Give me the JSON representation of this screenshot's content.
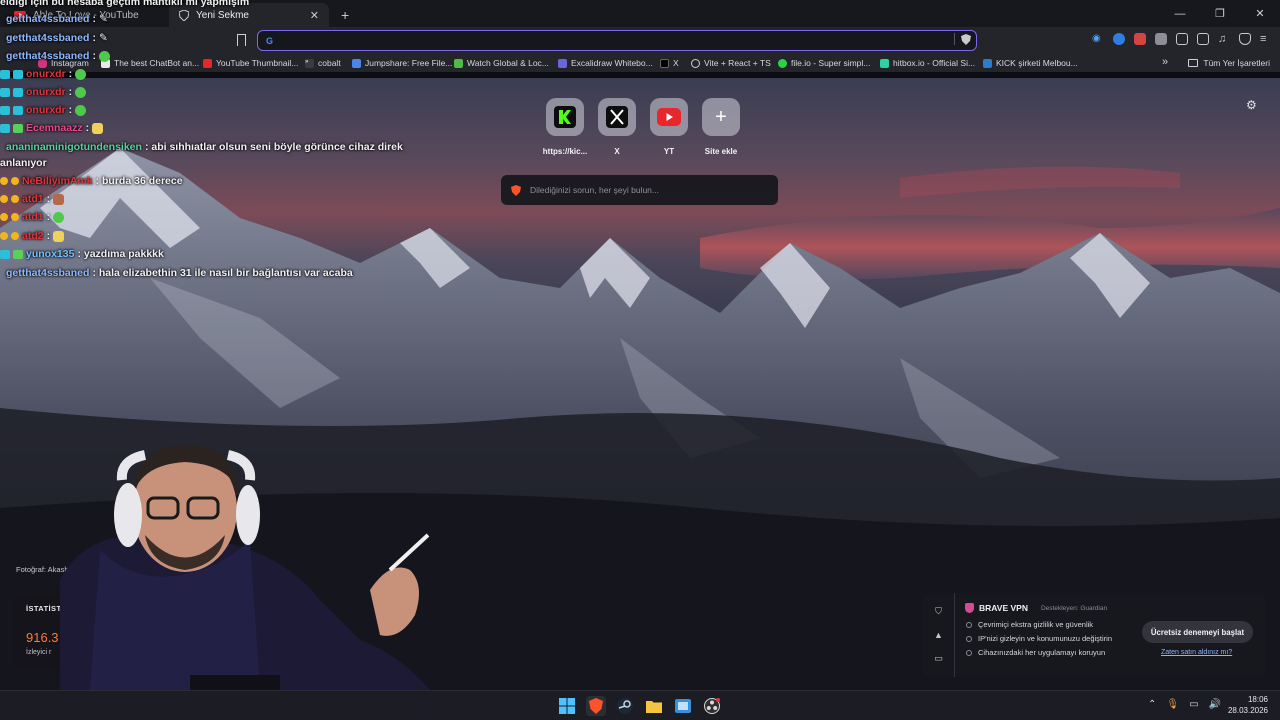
{
  "tabs": [
    {
      "label": "Able To Love - YouTube"
    },
    {
      "label": "Yeni Sekme"
    }
  ],
  "omnibox": {
    "value": ""
  },
  "bookmarks": [
    {
      "label": "Instagram",
      "icon": "instagram-icon",
      "color": "#d6347a"
    },
    {
      "label": "The best ChatBot an...",
      "icon": "chatbot-icon",
      "color": "#e8e8e8"
    },
    {
      "label": "YouTube Thumbnail...",
      "icon": "youtube-icon",
      "color": "#e8262b"
    },
    {
      "label": "cobalt",
      "icon": "cobalt-icon",
      "color": "#cfcfd6"
    },
    {
      "label": "Jumpshare: Free File...",
      "icon": "jumpshare-icon",
      "color": "#4a86e8"
    },
    {
      "label": "Watch Global & Loc...",
      "icon": "watch-icon",
      "color": "#53b84a"
    },
    {
      "label": "Excalidraw Whitebo...",
      "icon": "excalidraw-icon",
      "color": "#6965db"
    },
    {
      "label": "X",
      "icon": "x-icon",
      "color": "#ffffff"
    },
    {
      "label": "Vite + React + TS",
      "icon": "globe-icon",
      "color": "#cfcfd6"
    },
    {
      "label": "file.io - Super simpl...",
      "icon": "fileio-icon",
      "color": "#2bd34b"
    },
    {
      "label": "hitbox.io - Official Si...",
      "icon": "hitbox-icon",
      "color": "#2bd3a4"
    },
    {
      "label": "KICK şirketi Melbou...",
      "icon": "linkedin-icon",
      "color": "#2d7bc9"
    }
  ],
  "all_bookmarks_label": "Tüm Yer İşaretleri",
  "top_sites": [
    {
      "label": "https://kic...",
      "icon": "kick-icon"
    },
    {
      "label": "X",
      "icon": "x-icon"
    },
    {
      "label": "YT",
      "icon": "youtube-icon"
    },
    {
      "label": "Site ekle",
      "icon": "plus-icon"
    }
  ],
  "search": {
    "placeholder": "Dilediğinizi sorun, her şeyi bulun..."
  },
  "photo_credit": "Fotoğraf: Akash Mi",
  "stats": {
    "title": "İSTATİSTİKL",
    "value": "916.3",
    "subtitle": "İzleyici r"
  },
  "chat": [
    {
      "user": "",
      "text": "eldiği için bu hesaba geçtim mantıklı mı yapmışım",
      "color": "#ffffff"
    },
    {
      "user": "getthat4ssbaned",
      "text": ":",
      "color": "#8fb7ff"
    },
    {
      "user": "getthat4ssbaned",
      "text": ":",
      "color": "#8fb7ff"
    },
    {
      "user": "getthat4ssbaned",
      "text": ":",
      "color": "#8fb7ff"
    },
    {
      "user": "onurxdr",
      "text": ":",
      "color": "#e0343a"
    },
    {
      "user": "onurxdr",
      "text": ":",
      "color": "#e0343a"
    },
    {
      "user": "onurxdr",
      "text": ":",
      "color": "#e0343a"
    },
    {
      "user": "Ecemnaazz",
      "text": ":",
      "color": "#e84a8c"
    },
    {
      "user": "ananinaminigotundensiken",
      "text": ": abi sıhhıatlar olsun seni böyle görünce cihaz direk",
      "color": "#5ad0a0"
    },
    {
      "user": "",
      "text": "anlanıyor",
      "color": "#ffffff"
    },
    {
      "user": "NeBiliyimAmk",
      "text": ": burda 36 derece",
      "color": "#e0343a"
    },
    {
      "user": "atd1",
      "text": ":",
      "color": "#e0343a"
    },
    {
      "user": "atd1",
      "text": ":",
      "color": "#e0343a"
    },
    {
      "user": "atd2",
      "text": ":",
      "color": "#e0343a"
    },
    {
      "user": "yunox135",
      "text": ": yazdıma pakkkk",
      "color": "#6fc0ff"
    },
    {
      "user": "getthat4ssbaned",
      "text": ": hala elizabethin 31 ile nasıl bir bağlantısı var acaba",
      "color": "#8fb7ff"
    }
  ],
  "vpn": {
    "title": "BRAVE VPN",
    "sponsor": "Destekleyen: Guardian",
    "features": [
      "Çevrimiçi ekstra gizlilik ve güvenlik",
      "IP'nizi gizleyin ve konumunuzu değiştirin",
      "Cihazınızdaki her uygulamayı koruyun"
    ],
    "cta": "Ücretsiz denemeyi başlat",
    "link": "Zaten satın aldınız mı?"
  },
  "clock": {
    "time": "18:06",
    "date": "28.03.2026"
  },
  "colors": {
    "accent": "#7b68ee",
    "kick_green": "#53fc18",
    "youtube_red": "#e8262b"
  }
}
